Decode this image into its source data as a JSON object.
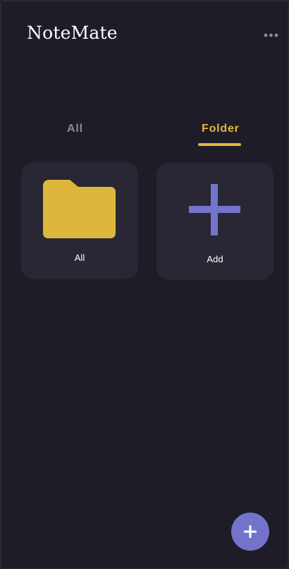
{
  "header": {
    "title": "NoteMate",
    "more_icon": "more-horizontal-icon"
  },
  "tabs": [
    {
      "label": "All",
      "active": false
    },
    {
      "label": "Folder",
      "active": true
    }
  ],
  "folders": [
    {
      "label": "All",
      "icon": "folder-icon"
    },
    {
      "label": "Add",
      "icon": "plus-icon"
    }
  ],
  "fab": {
    "icon": "plus-icon"
  },
  "colors": {
    "background": "#1e1d27",
    "card": "#282733",
    "accent_yellow": "#e0b83a",
    "accent_purple": "#7473cc",
    "inactive_text": "#8c8b95"
  }
}
